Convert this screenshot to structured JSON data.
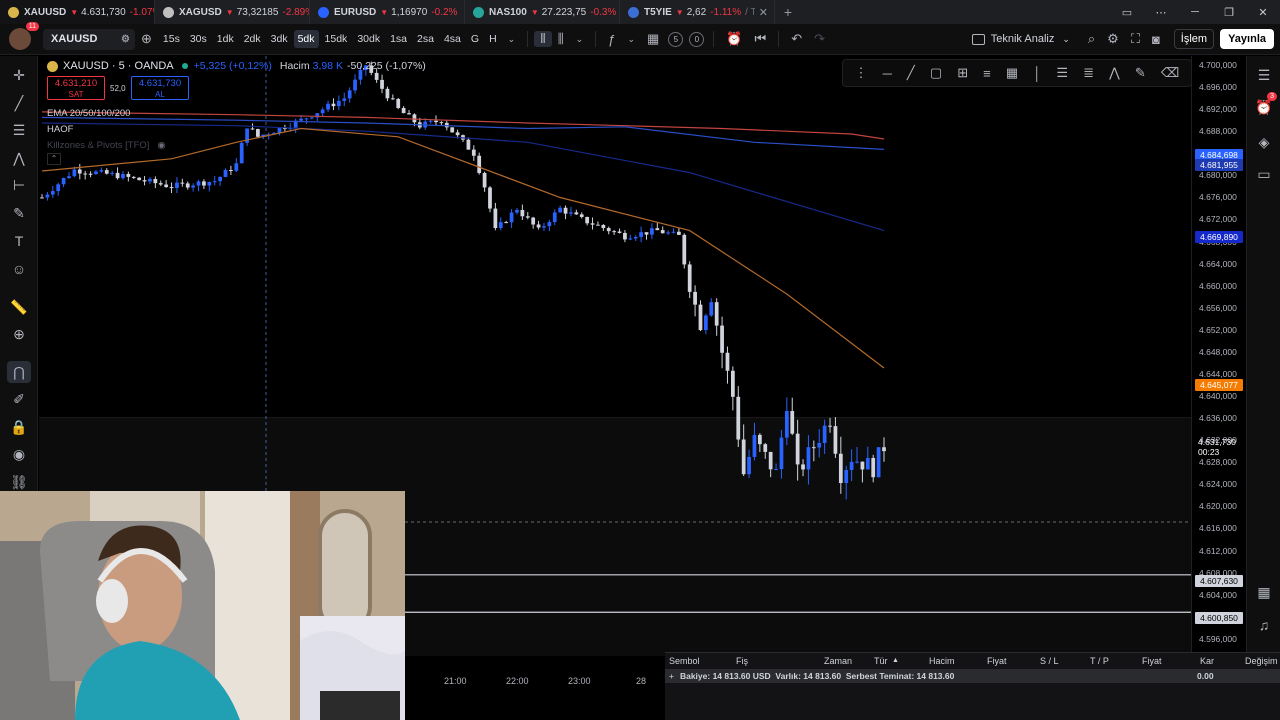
{
  "browser_tabs": [
    {
      "symbol": "XAUUSD",
      "price": "4.631,730",
      "change": "-1.07%",
      "extra": "",
      "icon_color": "#d9b54a"
    },
    {
      "symbol": "XAGUSD",
      "price": "73,32185",
      "change": "-2.89%",
      "extra": "",
      "icon_color": "#c0c0c0"
    },
    {
      "symbol": "EURUSD",
      "price": "1,16970",
      "change": "-0.2%",
      "extra": "/ 1",
      "icon_color": "#2962ff"
    },
    {
      "symbol": "NAS100",
      "price": "27.223,75",
      "change": "-0.3%",
      "extra": "",
      "icon_color": "#26a69a"
    },
    {
      "symbol": "T5YIE",
      "price": "2,62",
      "change": "-1.11%",
      "extra": "/ Tekn",
      "icon_color": "#3b6fd6"
    }
  ],
  "toolbar": {
    "avatar_badge": "11",
    "symbol": "XAUUSD",
    "intervals": [
      "15s",
      "30s",
      "1dk",
      "2dk",
      "3dk",
      "5dk",
      "15dk",
      "30dk",
      "1sa",
      "2sa",
      "4sa",
      "G",
      "H"
    ],
    "active_interval": "5dk",
    "counter_s": "5",
    "counter_0": "0",
    "technical_analysis": "Teknik Analiz",
    "trade_button": "İşlem",
    "publish_button": "Yayınla"
  },
  "legend": {
    "title": "XAUUSD · 5 · OANDA",
    "change": "+5,325 (+0,12%)",
    "volume_label": "Hacim",
    "volume_value": "3,98 K",
    "volume_change": "-50,225 (-1,07%)",
    "sell_price": "4.631,210",
    "sell_label": "SAT",
    "spread": "52,0",
    "buy_price": "4.631,730",
    "buy_label": "AL",
    "indicators": [
      "EMA 20/50/100/200",
      "HAOF",
      "Killzones & Pivots [TFO]"
    ]
  },
  "right_sidebar": {
    "alerts_badge": "3"
  },
  "price_axis": {
    "ticks": [
      "4.700,000",
      "4.696,000",
      "4.692,000",
      "4.688,000",
      "4.684,000",
      "4.680,000",
      "4.676,000",
      "4.672,000",
      "4.668,000",
      "4.664,000",
      "4.660,000",
      "4.656,000",
      "4.652,000",
      "4.648,000",
      "4.644,000",
      "4.640,000",
      "4.636,000",
      "4.632,000",
      "4.628,000",
      "4.624,000",
      "4.620,000",
      "4.616,000",
      "4.612,000",
      "4.608,000",
      "4.604,000",
      "4.600,000",
      "4.596,000"
    ],
    "labels": [
      {
        "text": "4.684,698",
        "color": "#2962ff"
      },
      {
        "text": "4.681,955",
        "color": "#1e3bb3"
      },
      {
        "text": "4.669,890",
        "color": "#1528c9"
      },
      {
        "text": "4.645,077",
        "color": "#f57c00"
      },
      {
        "text": "4.607,630",
        "color": "#d1d4dc"
      },
      {
        "text": "4.600,850",
        "color": "#d1d4dc"
      }
    ],
    "current_price": "4.631,730",
    "countdown": "00:23"
  },
  "time_axis": [
    "21:00",
    "22:00",
    "23:00",
    "28"
  ],
  "positions_panel": {
    "columns": [
      "Sembol",
      "Fiş",
      "Zaman",
      "Tür",
      "Hacim",
      "Fiyat",
      "S / L",
      "T / P",
      "Fiyat",
      "Kar",
      "Değişim"
    ],
    "balance_text": "Bakiye: 14 813.60 USD  Varlık: 14 813.60  Serbest Teminat: 14 813.60",
    "profit": "0.00"
  },
  "chart_data": {
    "type": "candlestick",
    "symbol": "XAUUSD",
    "interval": "5",
    "ylim": [
      4594,
      4702
    ],
    "x_ticks": [
      "21:00",
      "22:00",
      "23:00",
      "28"
    ],
    "anchors": [
      [
        0,
        4679,
        4676
      ],
      [
        6,
        4676,
        4681
      ],
      [
        14,
        4681,
        4680
      ],
      [
        24,
        4679,
        4678
      ],
      [
        32,
        4678,
        4679
      ],
      [
        36,
        4679,
        4682
      ],
      [
        38,
        4682,
        4689
      ],
      [
        40,
        4689,
        4687
      ],
      [
        48,
        4687,
        4690
      ],
      [
        56,
        4690,
        4694
      ],
      [
        60,
        4694,
        4700
      ],
      [
        62,
        4700,
        4697
      ],
      [
        66,
        4697,
        4692
      ],
      [
        70,
        4692,
        4689
      ],
      [
        74,
        4689,
        4690
      ],
      [
        78,
        4690,
        4686
      ],
      [
        80,
        4686,
        4684
      ],
      [
        82,
        4684,
        4678
      ],
      [
        84,
        4678,
        4670
      ],
      [
        88,
        4670,
        4674
      ],
      [
        92,
        4674,
        4670
      ],
      [
        96,
        4670,
        4674
      ],
      [
        100,
        4674,
        4672
      ],
      [
        108,
        4672,
        4669
      ],
      [
        114,
        4669,
        4670
      ],
      [
        118,
        4670,
        4669
      ],
      [
        120,
        4669,
        4660
      ],
      [
        122,
        4660,
        4653
      ],
      [
        124,
        4653,
        4658
      ],
      [
        126,
        4658,
        4648
      ],
      [
        128,
        4648,
        4640
      ],
      [
        130,
        4640,
        4626
      ],
      [
        132,
        4626,
        4632
      ],
      [
        136,
        4632,
        4626
      ],
      [
        138,
        4626,
        4639
      ],
      [
        140,
        4639,
        4626
      ],
      [
        146,
        4626,
        4636
      ],
      [
        148,
        4636,
        4626
      ],
      [
        150,
        4626,
        4629
      ],
      [
        152,
        4629,
        4628
      ],
      [
        154,
        4628,
        4627
      ],
      [
        156,
        4627,
        4631
      ]
    ],
    "ema": [
      {
        "color": "#c2453f",
        "points": [
          [
            0,
            4691.5
          ],
          [
            60,
            4691.0
          ],
          [
            100,
            4690.5
          ],
          [
            150,
            4689.5
          ],
          [
            180,
            4689.0
          ],
          [
            210,
            4688.5
          ],
          [
            250,
            4687.5
          ],
          [
            260,
            4686.6
          ]
        ]
      },
      {
        "color": "#2a4fc9",
        "points": [
          [
            0,
            4690.5
          ],
          [
            60,
            4690.0
          ],
          [
            100,
            4689.5
          ],
          [
            150,
            4688.5
          ],
          [
            180,
            4688.8
          ],
          [
            220,
            4686.0
          ],
          [
            260,
            4684.7
          ]
        ]
      },
      {
        "color": "#172a8c",
        "points": [
          [
            0,
            4689.5
          ],
          [
            60,
            4689.0
          ],
          [
            100,
            4688.0
          ],
          [
            150,
            4686.0
          ],
          [
            200,
            4680.5
          ],
          [
            260,
            4670.0
          ]
        ]
      },
      {
        "color": "#b36a2a",
        "points": [
          [
            0,
            4680.8
          ],
          [
            40,
            4683.0
          ],
          [
            60,
            4686.0
          ],
          [
            80,
            4688.5
          ],
          [
            110,
            4687.0
          ],
          [
            160,
            4676.0
          ],
          [
            200,
            4670.0
          ],
          [
            230,
            4658.5
          ],
          [
            260,
            4645.1
          ]
        ]
      }
    ],
    "horizontal_levels": [
      4617.2,
      4607.63,
      4600.85
    ]
  }
}
